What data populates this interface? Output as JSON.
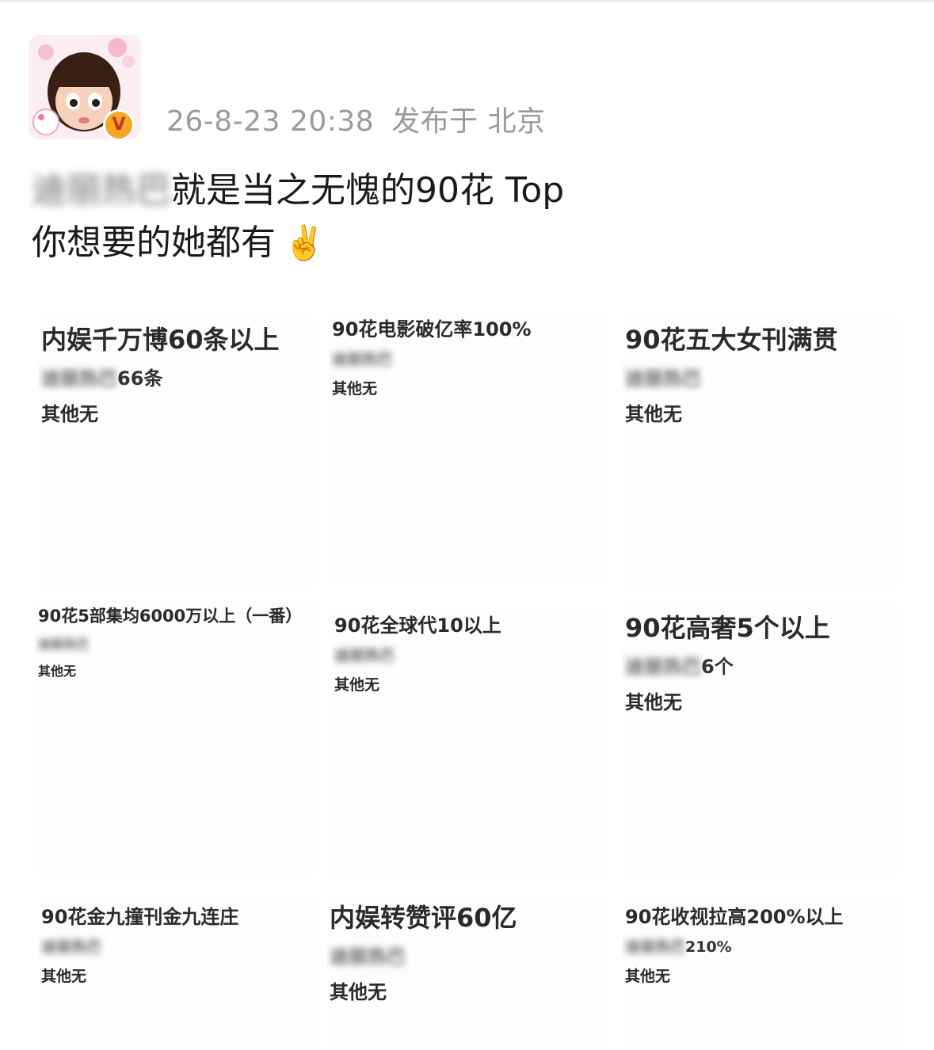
{
  "post": {
    "timestamp": "26-8-23 20:38",
    "location": "发布于 北京",
    "line1_blurred": "迪丽热巴",
    "line1_text": "就是当之无愧的90花 Top",
    "line2_text": "你想要的她都有",
    "emoji": "✌️"
  },
  "cards": [
    {
      "title": "内娱千万博60条以上",
      "name_blurred": "迪丽热巴",
      "name_suffix": "66条",
      "other": "其他无"
    },
    {
      "title": "90花电影破亿率100%",
      "name_blurred": "迪丽热巴",
      "name_suffix": "",
      "other": "其他无"
    },
    {
      "title": "90花五大女刊满贯",
      "name_blurred": "迪丽热巴",
      "name_suffix": "",
      "other": "其他无"
    },
    {
      "title": "90花5部集均6000万以上（一番）",
      "name_blurred": "迪丽热巴",
      "name_suffix": "",
      "other": "其他无"
    },
    {
      "title": "90花全球代10以上",
      "name_blurred": "迪丽热巴",
      "name_suffix": "",
      "other": "其他无"
    },
    {
      "title": "90花高奢5个以上",
      "name_blurred": "迪丽热巴",
      "name_suffix": "6个",
      "other": "其他无"
    },
    {
      "title": "90花金九撞刊金九连庄",
      "name_blurred": "迪丽热巴",
      "name_suffix": "",
      "other": "其他无"
    },
    {
      "title": "内娱转赞评60亿",
      "name_blurred": "迪丽热巴",
      "name_suffix": "",
      "other": "其他无"
    },
    {
      "title": "90花收视拉高200%以上",
      "name_blurred": "迪丽热巴",
      "name_suffix": "210%",
      "other": "其他无"
    }
  ]
}
